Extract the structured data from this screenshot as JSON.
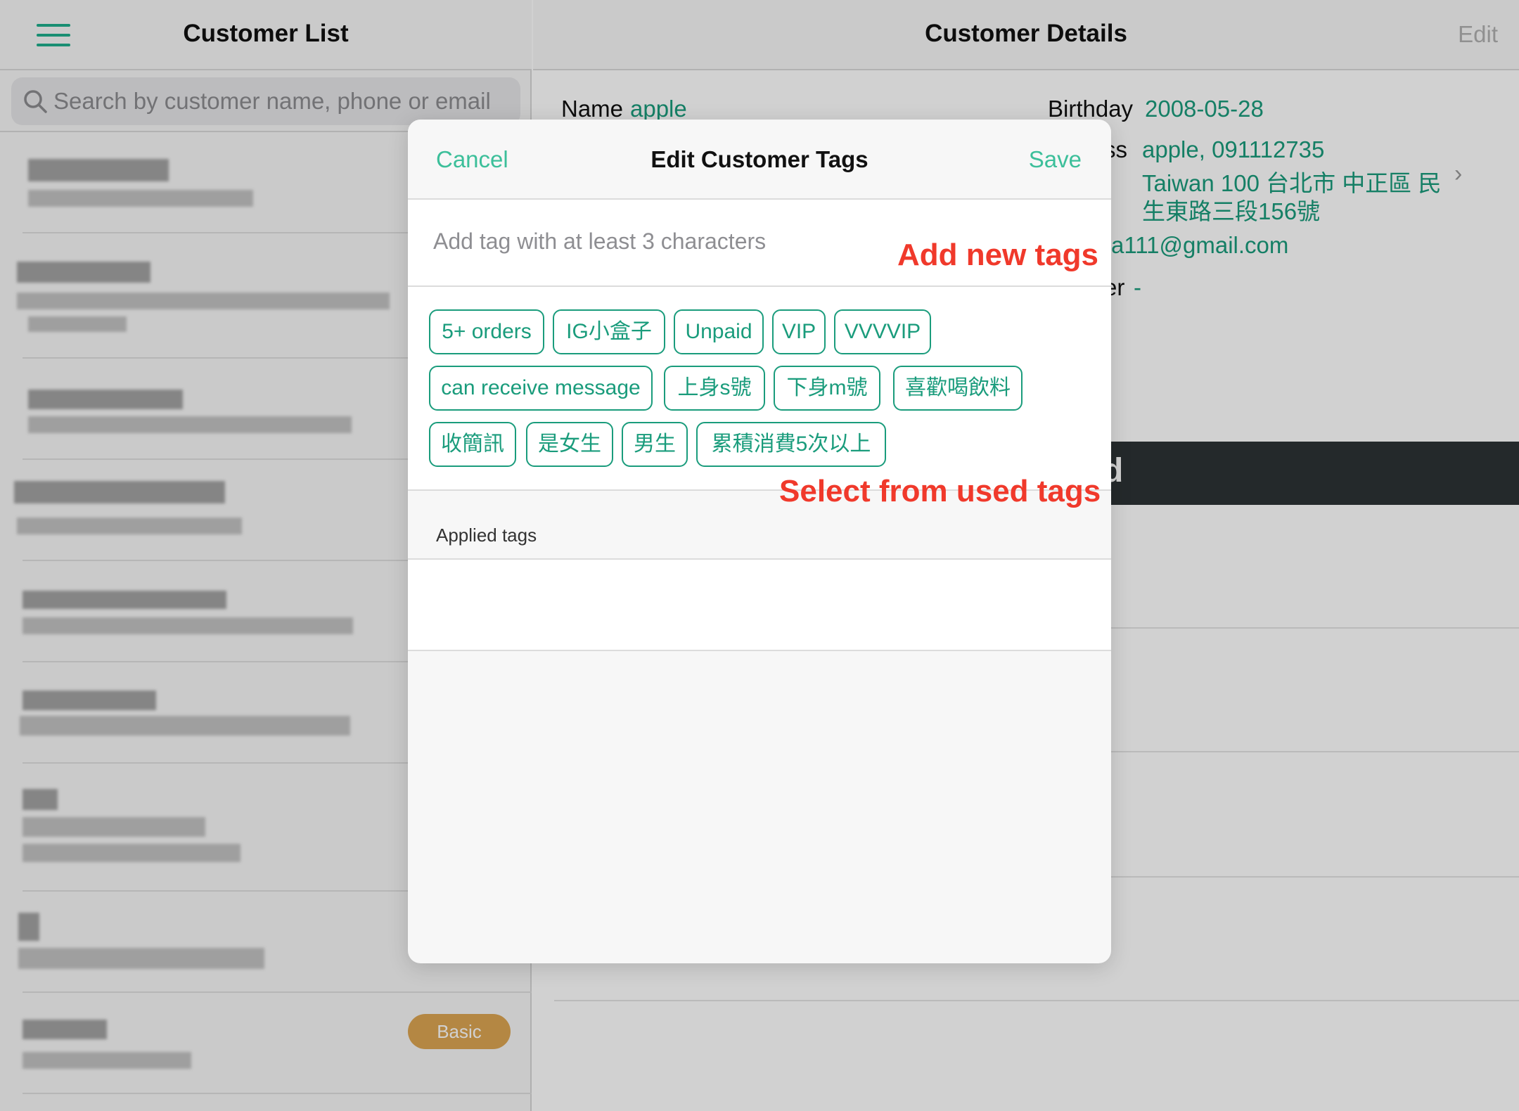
{
  "left_panel": {
    "title": "Customer List",
    "search_placeholder": "Search by customer name, phone or email",
    "badge": "Basic"
  },
  "right_panel": {
    "title": "Customer Details",
    "edit": "Edit",
    "name_label": "Name",
    "name_value": "apple",
    "birthday_label": "Birthday",
    "birthday_value": "2008-05-28",
    "address_label_partial": "ss",
    "address_line1": "apple, 091112735",
    "address_line2": "Taiwan 100 台北市 中正區 民",
    "address_line3": "生東路三段156號",
    "email_partial": "a111@gmail.com",
    "other_label_partial": "er",
    "other_value": "-",
    "dark_band_partial": "d"
  },
  "modal": {
    "cancel": "Cancel",
    "title": "Edit Customer Tags",
    "save": "Save",
    "input_placeholder": "Add tag with at least 3 characters",
    "annotation_add": "Add new tags",
    "annotation_select": "Select from used tags",
    "applied_label": "Applied tags",
    "tags": [
      "5+ orders",
      "IG小盒子",
      "Unpaid",
      "VIP",
      "VVVVIP",
      "can receive message",
      "上身s號",
      "下身m號",
      "喜歡喝飲料",
      "收簡訊",
      "是女生",
      "男生",
      "累積消費5次以上"
    ]
  },
  "colors": {
    "accent": "#1a9c7c",
    "accent_light": "#3cbf9a",
    "annotation": "#f0392b",
    "badge": "#dca552"
  }
}
